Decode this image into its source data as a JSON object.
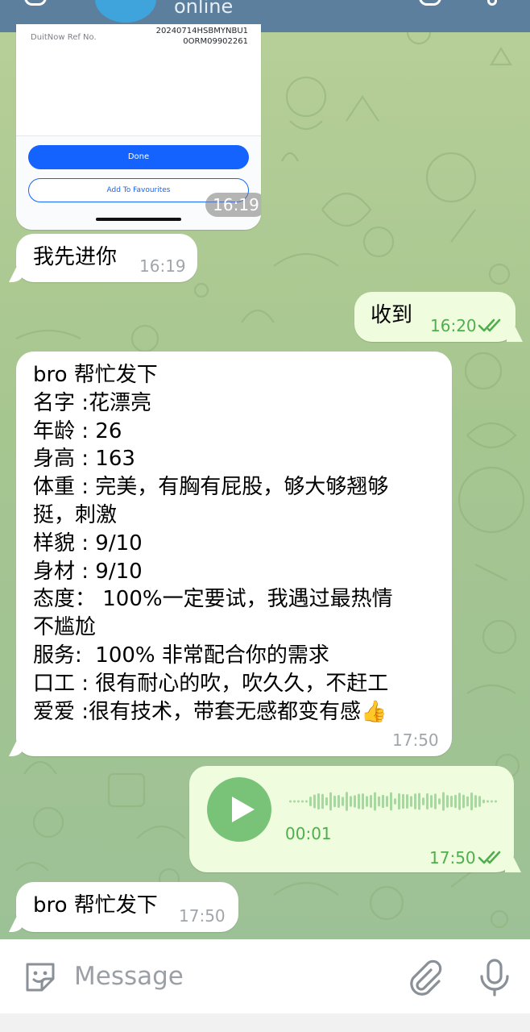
{
  "header": {
    "status": "online"
  },
  "receipt": {
    "ref_label": "DuitNow Ref No.",
    "ref_value_line1": "20240714HSBMYNBU1",
    "ref_value_line2": "0ORM09902261",
    "done_label": "Done",
    "favourites_label": "Add To Favourites",
    "time": "16:19"
  },
  "messages": [
    {
      "direction": "in",
      "text": "我先进你",
      "time": "16:19"
    },
    {
      "direction": "out",
      "text": "收到",
      "time": "16:20",
      "status": "read"
    },
    {
      "direction": "in",
      "lines": [
        "bro 帮忙发下",
        "名字 :花漂亮",
        "年龄 : 26",
        "身高 : 163",
        "体重 : 完美，有胸有屁股，够大够翘够",
        "挺，刺激",
        "样貌 : 9/10",
        "身材 : 9/10",
        "态度： 100%一定要试，我遇过最热情",
        "不尴尬",
        "服务:  100% 非常配合你的需求",
        "口工 : 很有耐心的吹，吹久久，不赶工",
        "爱爱 :很有技术，带套无感都变有感👍"
      ],
      "time": "17:50"
    },
    {
      "direction": "out",
      "type": "voice",
      "duration": "00:01",
      "time": "17:50",
      "status": "read"
    },
    {
      "direction": "in",
      "text": "bro 帮忙发下",
      "time": "17:50"
    }
  ],
  "input": {
    "placeholder": "Message"
  },
  "icons": {
    "sticker": "sticker-icon",
    "attach": "paperclip-icon",
    "mic": "microphone-icon",
    "play": "play-icon",
    "read": "double-check-icon"
  },
  "colors": {
    "header": "#5b7f9d",
    "outgoing_bubble": "#effdde",
    "incoming_bubble": "#ffffff",
    "accent_green": "#4fae4e",
    "play_button": "#78c378"
  }
}
